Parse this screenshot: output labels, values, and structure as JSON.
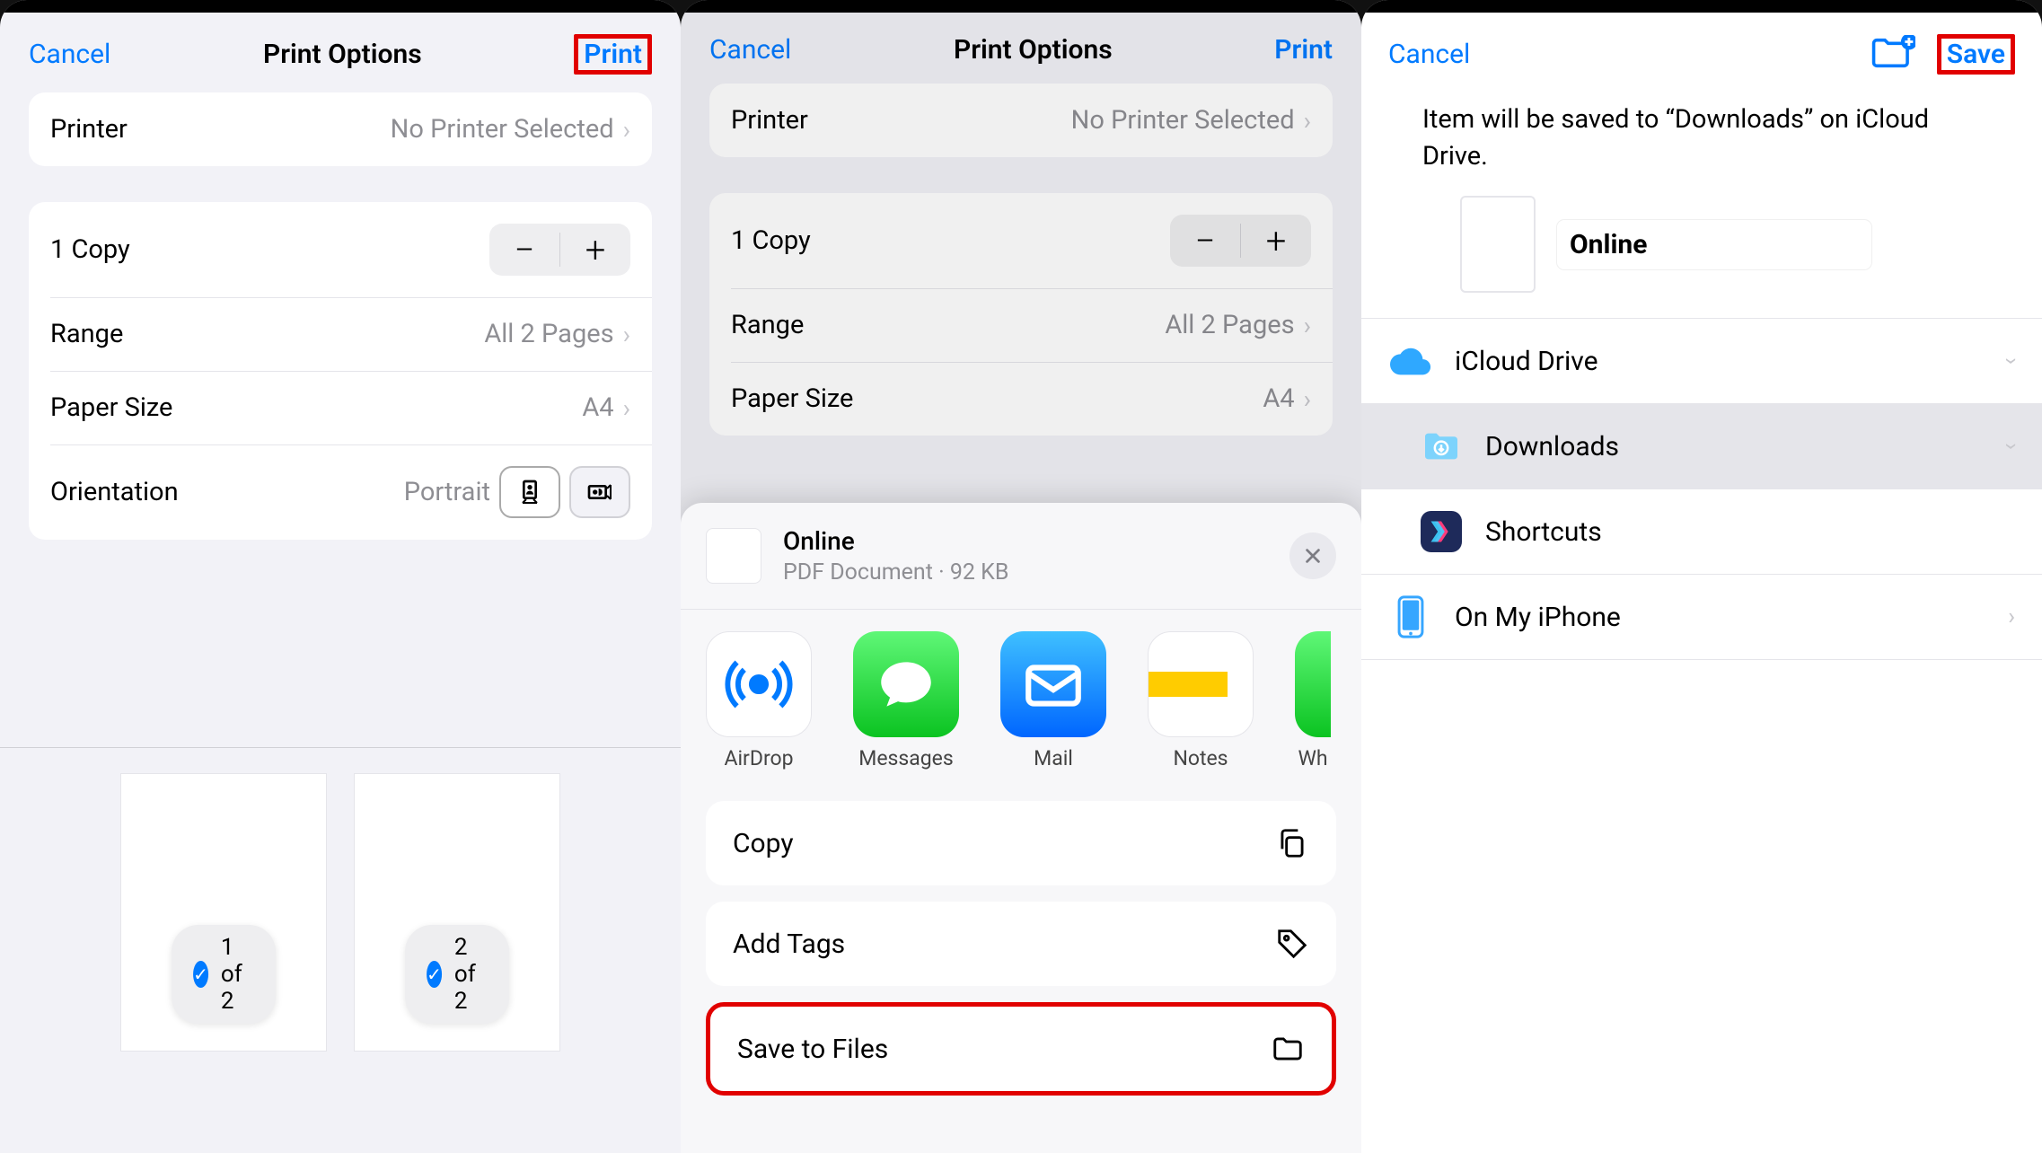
{
  "panel1": {
    "cancel": "Cancel",
    "title": "Print Options",
    "print": "Print",
    "printer_label": "Printer",
    "printer_value": "No Printer Selected",
    "copies": "1 Copy",
    "range_label": "Range",
    "range_value": "All 2 Pages",
    "paper_label": "Paper Size",
    "paper_value": "A4",
    "orient_label": "Orientation",
    "orient_value": "Portrait",
    "page1": "1 of 2",
    "page2": "2 of 2"
  },
  "panel2": {
    "cancel": "Cancel",
    "title": "Print Options",
    "print": "Print",
    "printer_label": "Printer",
    "printer_value": "No Printer Selected",
    "copies": "1 Copy",
    "range_label": "Range",
    "range_value": "All 2 Pages",
    "paper_label": "Paper Size",
    "paper_value": "A4",
    "share_name": "Online",
    "share_meta": "PDF Document · 92 KB",
    "apps": [
      "AirDrop",
      "Messages",
      "Mail",
      "Notes",
      "Wh"
    ],
    "copy": "Copy",
    "addtags": "Add Tags",
    "savefiles": "Save to Files"
  },
  "panel3": {
    "cancel": "Cancel",
    "save": "Save",
    "desc": "Item will be saved to “Downloads” on iCloud Drive.",
    "filename": "Online",
    "loc_icloud": "iCloud Drive",
    "loc_downloads": "Downloads",
    "loc_shortcuts": "Shortcuts",
    "loc_iphone": "On My iPhone"
  }
}
